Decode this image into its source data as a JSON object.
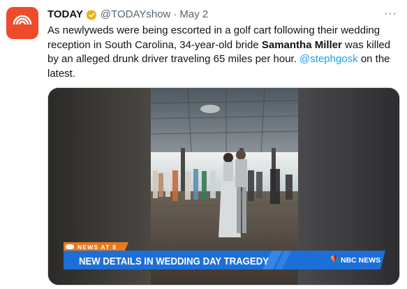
{
  "account": {
    "name": "TODAY",
    "handle": "@TODAYshow",
    "separator": "·",
    "date": "May 2"
  },
  "more_label": "···",
  "text": {
    "part1": "As newlyweds were being escorted in a golf cart following their wedding reception in South Carolina, 34-year-old bride ",
    "bold": "Samantha Miller",
    "part2": " was killed by an alleged drunk driver traveling 65 miles per hour. ",
    "mention": "@stephgosk",
    "part3": " on the latest."
  },
  "video": {
    "banner_tag": "NEWS AT 8",
    "headline": "NEW DETAILS IN WEDDING DAY TRAGEDY",
    "network": "NBC NEWS"
  },
  "colors": {
    "brand": "#ee4b2b",
    "verified_badge": "#e2b719",
    "link": "#1d9bf0",
    "banner_blue": "#1d6fd8",
    "banner_orange": "#e8791f"
  },
  "icons": {
    "avatar": "today-logo-icon",
    "verified": "verified-badge-icon",
    "more": "more-icon",
    "network": "nbc-peacock-icon"
  }
}
